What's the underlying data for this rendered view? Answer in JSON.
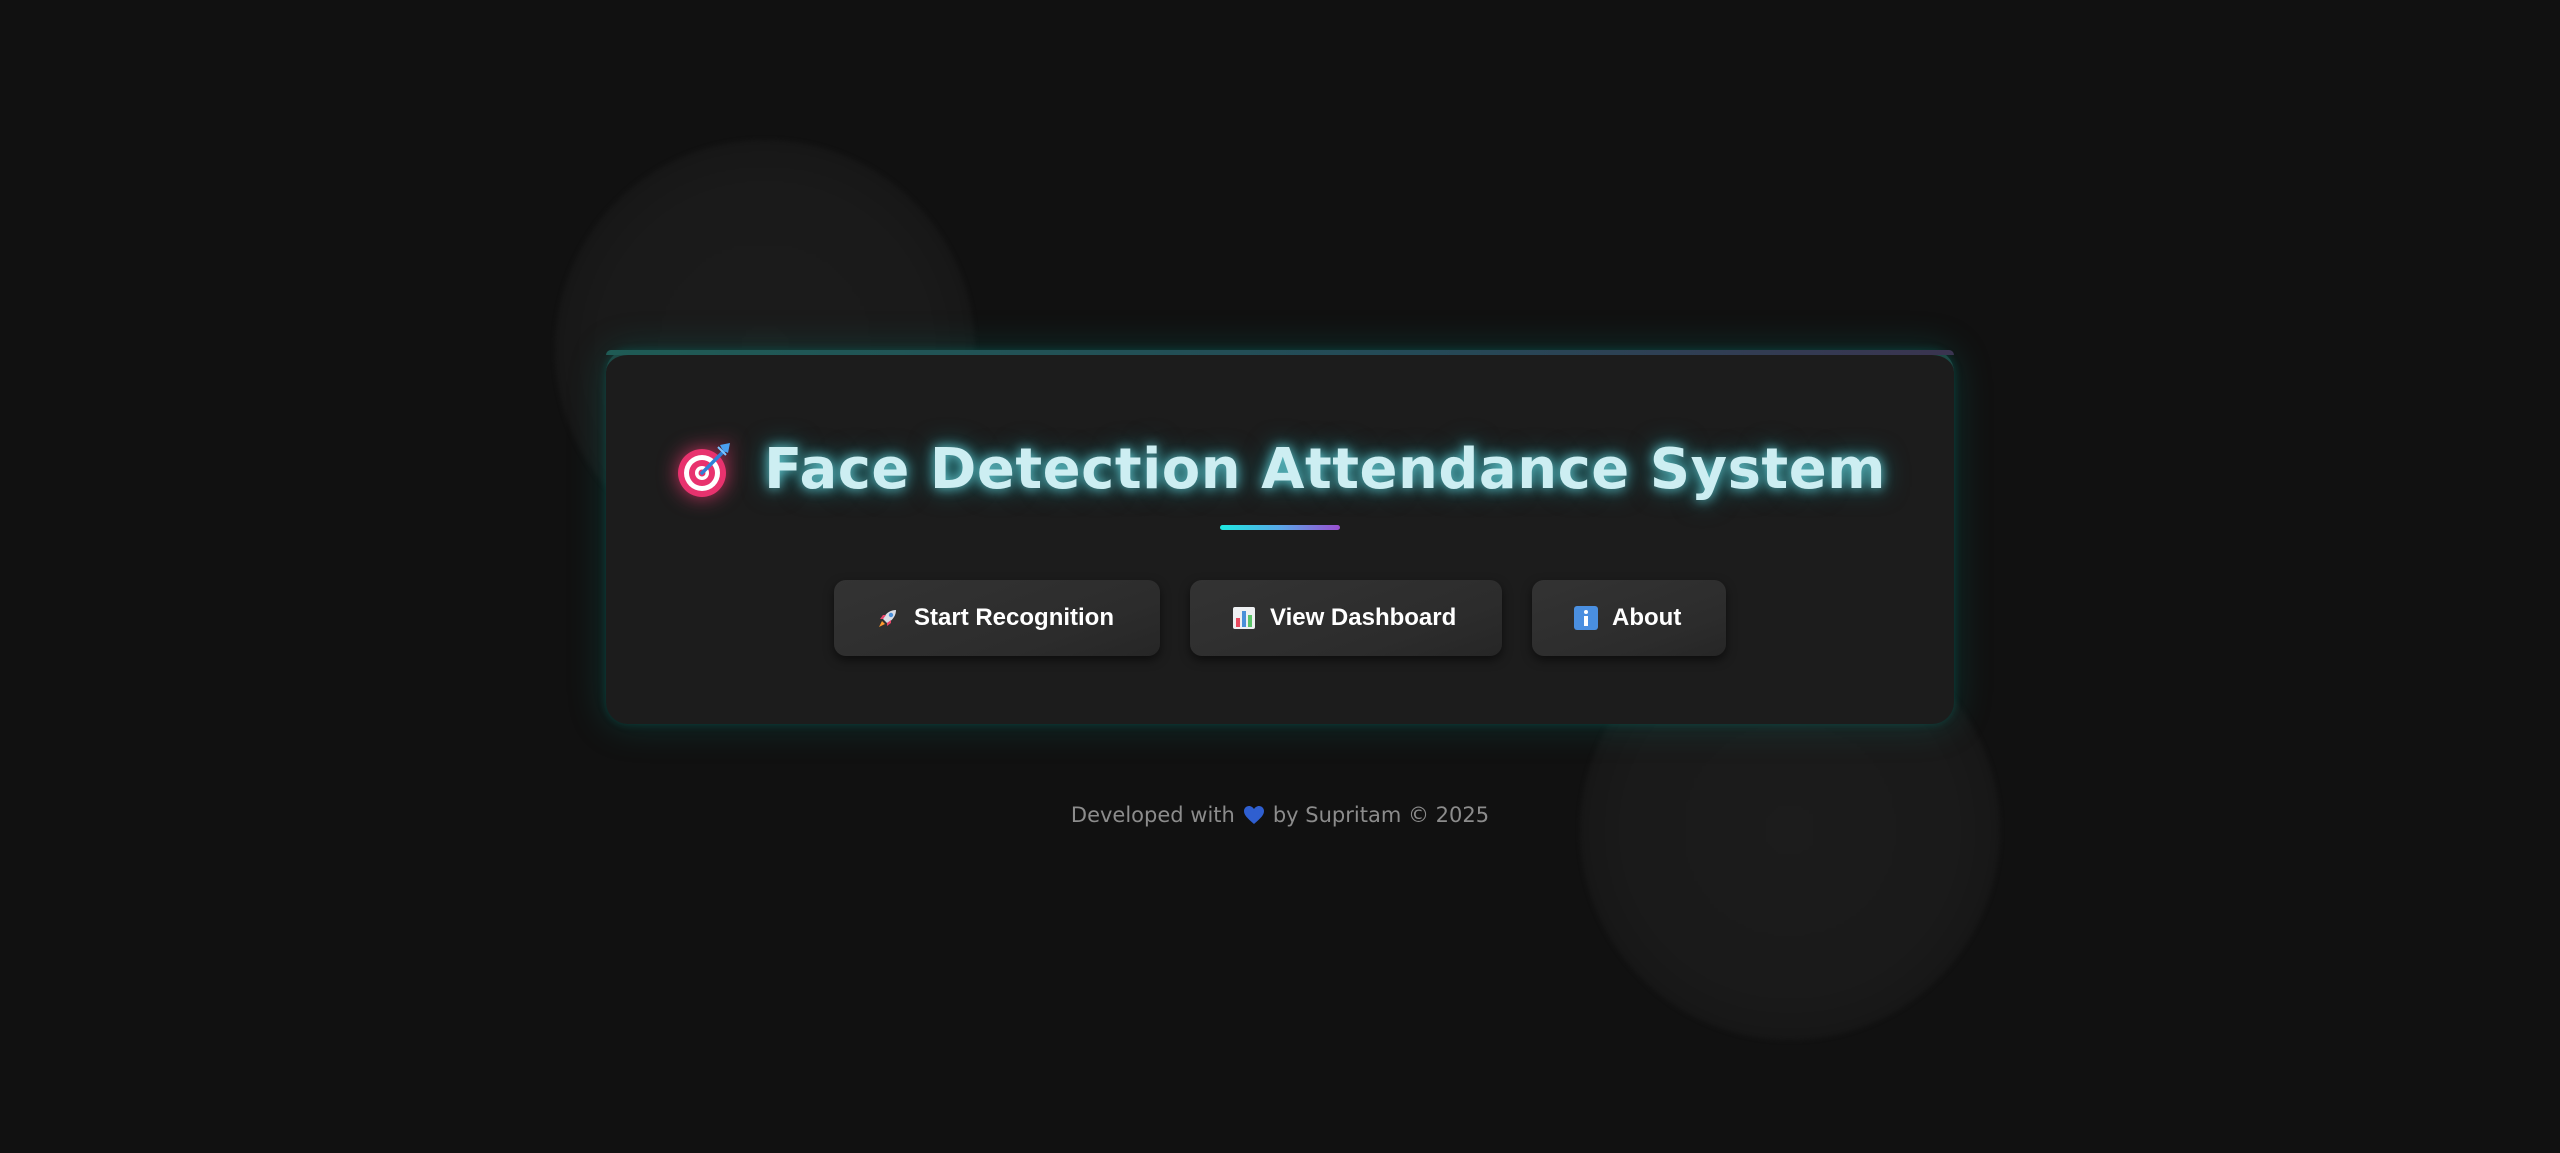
{
  "title": "Face Detection Attendance System",
  "title_icon": "target-icon",
  "buttons": [
    {
      "label": "Start Recognition",
      "icon": "rocket-icon"
    },
    {
      "label": "View Dashboard",
      "icon": "bar-chart-icon"
    },
    {
      "label": "About",
      "icon": "info-icon"
    }
  ],
  "footer": {
    "before": "Developed with",
    "icon": "blue-heart-icon",
    "after": "by Supritam © 2025"
  },
  "colors": {
    "background": "#111111",
    "card": "#1c1c1c",
    "title_glow": "#00c8d2",
    "button": "#2e2e2e",
    "accent_gradient_start": "#1de9e0",
    "accent_gradient_end": "#9a4fd0"
  }
}
